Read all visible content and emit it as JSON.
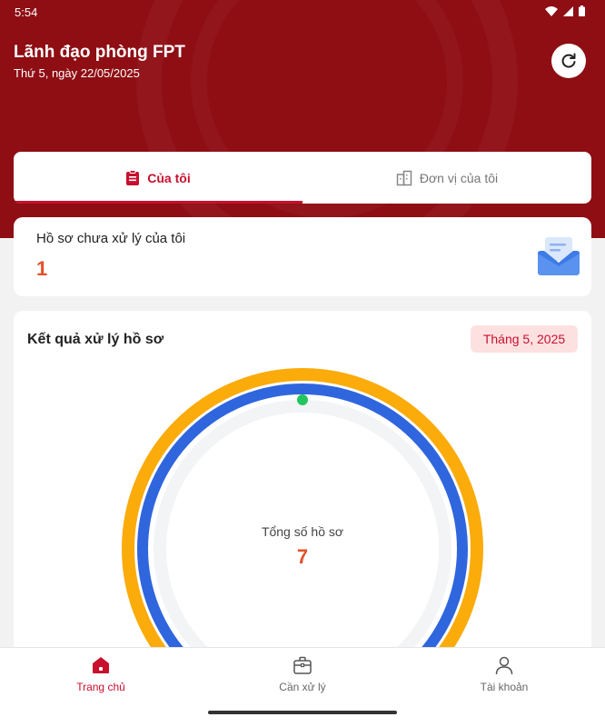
{
  "status_bar": {
    "time": "5:54"
  },
  "header": {
    "title": "Lãnh đạo phòng FPT",
    "date": "Thứ 5, ngày 22/05/2025"
  },
  "tabs": [
    {
      "label": "Của tôi",
      "active": true
    },
    {
      "label": "Đơn vị của tôi",
      "active": false
    }
  ],
  "pending_card": {
    "label": "Hồ sơ chưa xử lý của tôi",
    "value": "1"
  },
  "results_card": {
    "title": "Kết quả xử lý hồ sơ",
    "month": "Tháng 5, 2025",
    "total_label": "Tổng số hồ sơ",
    "total_value": "7"
  },
  "bottom_nav": [
    {
      "label": "Trang chủ",
      "active": true
    },
    {
      "label": "Cần xử lý",
      "active": false
    },
    {
      "label": "Tài khoản",
      "active": false
    }
  ],
  "colors": {
    "brand": "#8e0e14",
    "accent": "#c8102e",
    "number": "#e5502a",
    "ring_outer": "#fbab0a",
    "ring_inner": "#2f66de",
    "dot": "#22c55e"
  }
}
